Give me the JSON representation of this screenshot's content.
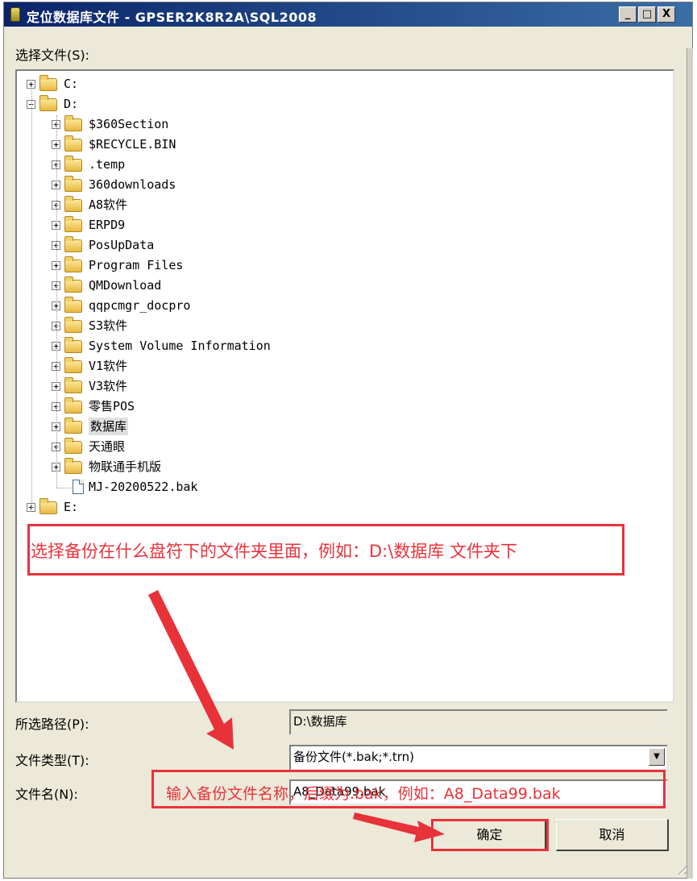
{
  "window": {
    "title": "定位数据库文件 - GPSER2K8R2A\\SQL2008",
    "minimize": "_",
    "maximize": "□",
    "close": "X"
  },
  "select_label": "选择文件(S):",
  "tree": {
    "drives": [
      {
        "label": "C:",
        "expander": "+"
      },
      {
        "label": "D:",
        "expander": "−"
      },
      {
        "label": "E:",
        "expander": "+"
      }
    ],
    "d_children": [
      "$360Section",
      "$RECYCLE.BIN",
      ".temp",
      "360downloads",
      "A8软件",
      "ERPD9",
      "PosUpData",
      "Program Files",
      "QMDownload",
      "qqpcmgr_docpro",
      "S3软件",
      "System Volume Information",
      "V1软件",
      "V3软件",
      "零售POS",
      "数据库",
      "天通眼",
      "物联通手机版"
    ],
    "d_file": "MJ-20200522.bak",
    "selected": "数据库"
  },
  "selected_path": {
    "label": "所选路径(P):",
    "value": "D:\\数据库"
  },
  "file_type": {
    "label": "文件类型(T):",
    "value": "备份文件(*.bak;*.trn)"
  },
  "file_name": {
    "label": "文件名(N):",
    "value": "A8_Data99.bak"
  },
  "buttons": {
    "ok": "确定",
    "cancel": "取消"
  },
  "annotations": {
    "folder_hint": "选择备份在什么盘符下的文件夹里面，例如：D:\\数据库 文件夹下",
    "filename_hint": "输入备份文件名称，后缀为.bak，例如：A8_Data99.bak"
  },
  "colors": {
    "annotation": "#e8323a",
    "titlebar": "#0a246a"
  }
}
